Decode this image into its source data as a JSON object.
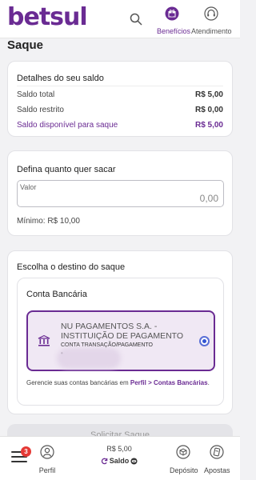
{
  "header": {
    "logo": "betsul",
    "beneficios": "Benefícios",
    "atendimento": "Atendimento"
  },
  "page": {
    "title": "Saque"
  },
  "balance": {
    "title": "Detalhes do seu saldo",
    "rows": [
      {
        "label": "Saldo total",
        "value": "R$ 5,00"
      },
      {
        "label": "Saldo restrito",
        "value": "R$ 0,00"
      },
      {
        "label": "Saldo disponível para saque",
        "value": "R$ 5,00"
      }
    ]
  },
  "amount": {
    "title": "Defina quanto quer sacar",
    "field_label": "Valor",
    "field_value": "0,00",
    "minimum": "Mínimo: R$ 10,00"
  },
  "destination": {
    "title": "Escolha o destino do saque",
    "section": "Conta Bancária",
    "bank_name": "NU PAGAMENTOS S.A. - INSTITUIÇÃO DE PAGAMENTO",
    "account_type": "CONTA TRANSAÇÃO/PAGAMENTO",
    "account_masked": "•",
    "manage_text": "Gerencie suas contas bancárias em",
    "manage_link": "Perfil > Contas Bancárias",
    "manage_end": "."
  },
  "submit": {
    "label": "Solicitar Saque"
  },
  "bottom_nav": {
    "badge": "3",
    "perfil": "Perfil",
    "saldo_value": "R$ 5,00",
    "saldo_label": "Saldo",
    "deposito": "Depósito",
    "apostas": "Apostas"
  },
  "colors": {
    "brand": "#6a2b93",
    "radio": "#3355d4",
    "badge": "#e53935"
  }
}
